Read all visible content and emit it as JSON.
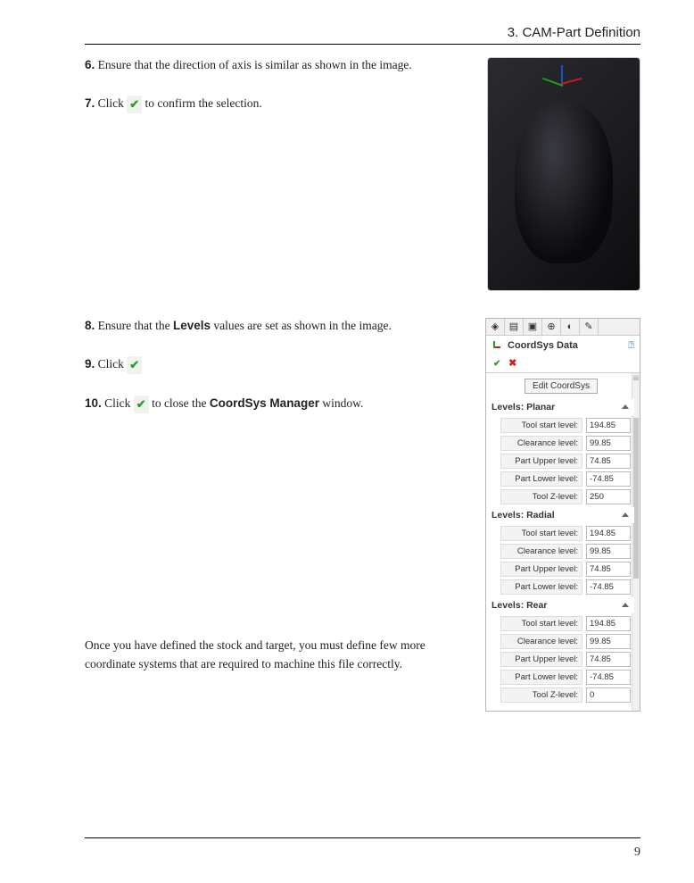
{
  "header": {
    "title": "3. CAM-Part Definition"
  },
  "steps": {
    "s6": {
      "num": "6.",
      "text": "Ensure that the direction of axis is similar as shown in the image."
    },
    "s7": {
      "num": "7.",
      "pre": "Click",
      "post": "to confirm the selection."
    },
    "s8": {
      "num": "8.",
      "pre": "Ensure that the ",
      "bold": "Levels",
      "post": " values are set as shown in the image."
    },
    "s9": {
      "num": "9.",
      "pre": "Click"
    },
    "s10": {
      "num": "10.",
      "pre": "Click",
      "post_a": "to close the ",
      "bold": "CoordSys Manager",
      "post_b": " window."
    }
  },
  "paragraph": "Once you have defined the stock and target, you must define few more coordinate systems that are required to machine this file correctly.",
  "panel": {
    "title": "CoordSys Data",
    "edit_btn": "Edit CoordSys",
    "toolbar": {
      "i1": "◈",
      "i2": "▤",
      "i3": "▣",
      "i4": "⊕",
      "i5": "◐",
      "i6": "✎"
    },
    "sections": {
      "planar": {
        "title": "Levels: Planar",
        "rows": {
          "tsl": {
            "label": "Tool start level:",
            "value": "194.85"
          },
          "cl": {
            "label": "Clearance level:",
            "value": "99.85"
          },
          "pul": {
            "label": "Part Upper level:",
            "value": "74.85"
          },
          "pll": {
            "label": "Part Lower level:",
            "value": "-74.85"
          },
          "tz": {
            "label": "Tool Z-level:",
            "value": "250"
          }
        }
      },
      "radial": {
        "title": "Levels: Radial",
        "rows": {
          "tsl": {
            "label": "Tool start level:",
            "value": "194.85"
          },
          "cl": {
            "label": "Clearance level:",
            "value": "99.85"
          },
          "pul": {
            "label": "Part Upper level:",
            "value": "74.85"
          },
          "pll": {
            "label": "Part Lower level:",
            "value": "-74.85"
          }
        }
      },
      "rear": {
        "title": "Levels: Rear",
        "rows": {
          "tsl": {
            "label": "Tool start level:",
            "value": "194.85"
          },
          "cl": {
            "label": "Clearance level:",
            "value": "99.85"
          },
          "pul": {
            "label": "Part Upper level:",
            "value": "74.85"
          },
          "pll": {
            "label": "Part Lower level:",
            "value": "-74.85"
          },
          "tz": {
            "label": "Tool Z-level:",
            "value": "0"
          }
        }
      }
    }
  },
  "page_number": "9"
}
